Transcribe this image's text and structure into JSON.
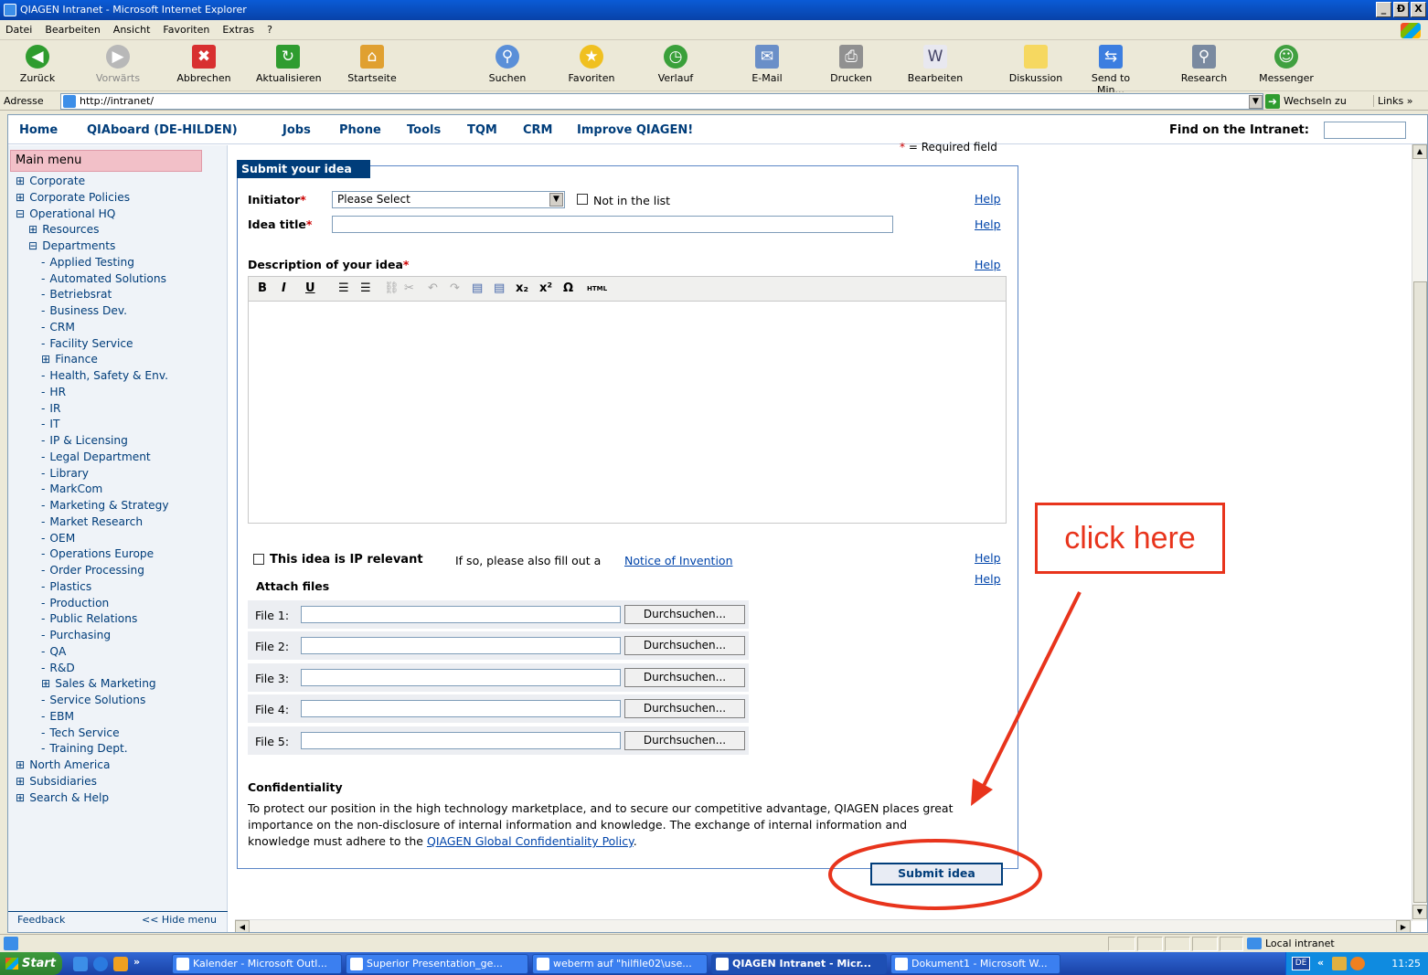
{
  "window": {
    "title": "QIAGEN Intranet - Microsoft Internet Explorer",
    "buttons": [
      "_",
      "Ɖ",
      "X"
    ]
  },
  "menubar": [
    "Datei",
    "Bearbeiten",
    "Ansicht",
    "Favoriten",
    "Extras",
    "?"
  ],
  "toolbar": [
    {
      "label": "Zurück",
      "icon": "back-icon"
    },
    {
      "label": "Vorwärts",
      "icon": "forward-icon"
    },
    {
      "label": "Abbrechen",
      "icon": "stop-icon"
    },
    {
      "label": "Aktualisieren",
      "icon": "refresh-icon"
    },
    {
      "label": "Startseite",
      "icon": "home-icon"
    },
    {
      "label": "Suchen",
      "icon": "search-icon"
    },
    {
      "label": "Favoriten",
      "icon": "favorites-icon"
    },
    {
      "label": "Verlauf",
      "icon": "history-icon"
    },
    {
      "label": "E-Mail",
      "icon": "mail-icon"
    },
    {
      "label": "Drucken",
      "icon": "print-icon"
    },
    {
      "label": "Bearbeiten",
      "icon": "edit-icon"
    },
    {
      "label": "Diskussion",
      "icon": "discussion-icon"
    },
    {
      "label": "Send to Min...",
      "icon": "send-to-mindmap-icon"
    },
    {
      "label": "Research",
      "icon": "research-icon"
    },
    {
      "label": "Messenger",
      "icon": "messenger-icon"
    }
  ],
  "address": {
    "label": "Adresse",
    "url": "http://intranet/",
    "go_label": "Wechseln zu",
    "links_label": "Links"
  },
  "topnav": {
    "items": [
      "Home",
      "QIAboard (DE-HILDEN)",
      "Jobs",
      "Phone",
      "Tools",
      "TQM",
      "CRM",
      "Improve QIAGEN!"
    ],
    "find_label": "Find on the Intranet:"
  },
  "sidebar": {
    "title": "Main menu",
    "items": [
      {
        "label": "Corporate",
        "marker": "⊞",
        "level": 0
      },
      {
        "label": "Corporate Policies",
        "marker": "⊞",
        "level": 0
      },
      {
        "label": "Operational HQ",
        "marker": "⊟",
        "level": 0
      },
      {
        "label": "Resources",
        "marker": "⊞",
        "level": 1
      },
      {
        "label": "Departments",
        "marker": "⊟",
        "level": 1
      },
      {
        "label": "Applied Testing",
        "marker": "-",
        "level": 2
      },
      {
        "label": "Automated Solutions",
        "marker": "-",
        "level": 2
      },
      {
        "label": "Betriebsrat",
        "marker": "-",
        "level": 2
      },
      {
        "label": "Business Dev.",
        "marker": "-",
        "level": 2
      },
      {
        "label": "CRM",
        "marker": "-",
        "level": 2
      },
      {
        "label": "Facility Service",
        "marker": "-",
        "level": 2
      },
      {
        "label": "Finance",
        "marker": "⊞",
        "level": 2
      },
      {
        "label": "Health, Safety & Env.",
        "marker": "-",
        "level": 2
      },
      {
        "label": "HR",
        "marker": "-",
        "level": 2
      },
      {
        "label": "IR",
        "marker": "-",
        "level": 2
      },
      {
        "label": "IT",
        "marker": "-",
        "level": 2
      },
      {
        "label": "IP & Licensing",
        "marker": "-",
        "level": 2
      },
      {
        "label": "Legal Department",
        "marker": "-",
        "level": 2
      },
      {
        "label": "Library",
        "marker": "-",
        "level": 2
      },
      {
        "label": "MarkCom",
        "marker": "-",
        "level": 2
      },
      {
        "label": "Marketing & Strategy",
        "marker": "-",
        "level": 2
      },
      {
        "label": "Market Research",
        "marker": "-",
        "level": 2
      },
      {
        "label": "OEM",
        "marker": "-",
        "level": 2
      },
      {
        "label": "Operations Europe",
        "marker": "-",
        "level": 2
      },
      {
        "label": "Order Processing",
        "marker": "-",
        "level": 2
      },
      {
        "label": "Plastics",
        "marker": "-",
        "level": 2
      },
      {
        "label": "Production",
        "marker": "-",
        "level": 2
      },
      {
        "label": "Public Relations",
        "marker": "-",
        "level": 2
      },
      {
        "label": "Purchasing",
        "marker": "-",
        "level": 2
      },
      {
        "label": "QA",
        "marker": "-",
        "level": 2
      },
      {
        "label": "R&D",
        "marker": "-",
        "level": 2
      },
      {
        "label": "Sales & Marketing",
        "marker": "⊞",
        "level": 2
      },
      {
        "label": "Service Solutions",
        "marker": "-",
        "level": 2
      },
      {
        "label": "EBM",
        "marker": "-",
        "level": 2
      },
      {
        "label": "Tech Service",
        "marker": "-",
        "level": 2
      },
      {
        "label": "Training Dept.",
        "marker": "-",
        "level": 2
      },
      {
        "label": "North America",
        "marker": "⊞",
        "level": 0
      },
      {
        "label": "Subsidiaries",
        "marker": "⊞",
        "level": 0
      },
      {
        "label": "Search & Help",
        "marker": "⊞",
        "level": 0
      }
    ],
    "feedback": "Feedback",
    "hide_menu": "<< Hide menu"
  },
  "form": {
    "tab_title": "Submit your idea",
    "required_note": "= Required field",
    "required_marker": "*",
    "initiator_label": "Initiator",
    "initiator_value": "Please Select",
    "not_in_list": "Not in the list",
    "idea_title_label": "Idea title",
    "description_label": "Description of your idea",
    "help": "Help",
    "ip_relevant_label": "This idea is IP relevant",
    "ip_note": "If so, please also fill out a",
    "ip_link": "Notice of Invention",
    "attach_label": "Attach files",
    "files": [
      {
        "label": "File 1:",
        "button": "Durchsuchen..."
      },
      {
        "label": "File 2:",
        "button": "Durchsuchen..."
      },
      {
        "label": "File 3:",
        "button": "Durchsuchen..."
      },
      {
        "label": "File 4:",
        "button": "Durchsuchen..."
      },
      {
        "label": "File 5:",
        "button": "Durchsuchen..."
      }
    ],
    "confidentiality_label": "Confidentiality",
    "confidentiality_text": "To protect our position in the high technology marketplace, and to secure our competitive advantage, QIAGEN places great importance on the non-disclosure of internal information and knowledge. The exchange of internal information and knowledge must adhere to the",
    "confidentiality_link": "QIAGEN Global Confidentiality Policy",
    "submit_label": "Submit idea"
  },
  "editor_buttons": [
    "B",
    "I",
    "U",
    "☰",
    "☰",
    "⛓",
    "✂",
    "↶",
    "↷",
    "▤",
    "▤",
    "x₂",
    "x²",
    "Ω",
    "HTML"
  ],
  "annotation": {
    "text": "click here",
    "color": "#e8341c"
  },
  "statusbar": {
    "zone": "Local intranet"
  },
  "taskbar": {
    "start": "Start",
    "tasks": [
      {
        "label": "Kalender - Microsoft Outl...",
        "active": false
      },
      {
        "label": "Superior Presentation_ge...",
        "active": false
      },
      {
        "label": "weberm auf \"hilfile02\\use...",
        "active": false
      },
      {
        "label": "QIAGEN Intranet - Micr...",
        "active": true
      },
      {
        "label": "Dokument1 - Microsoft W...",
        "active": false
      }
    ],
    "lang": "DE",
    "clock": "11:25"
  },
  "colors": {
    "brand": "#003d7a",
    "link": "#0044aa",
    "required": "#cc0000",
    "menu_header": "#f2c0c8"
  }
}
